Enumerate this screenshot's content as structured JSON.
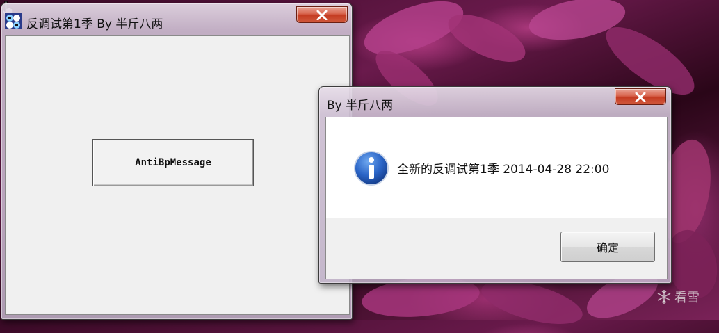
{
  "main_window": {
    "title": "反调试第1季 By 半斤八两",
    "button_label": "AntiBpMessage",
    "app_icon": "app-icon"
  },
  "message_box": {
    "title": "By 半斤八两",
    "icon": "info-icon",
    "message": "全新的反调试第1季 2014-04-28 22:00",
    "ok_label": "确定"
  },
  "watermark": {
    "text": "看雪",
    "icon": "snowflake-icon"
  },
  "colors": {
    "close_button": "#c43c22",
    "info_icon": "#1f5fc0"
  }
}
